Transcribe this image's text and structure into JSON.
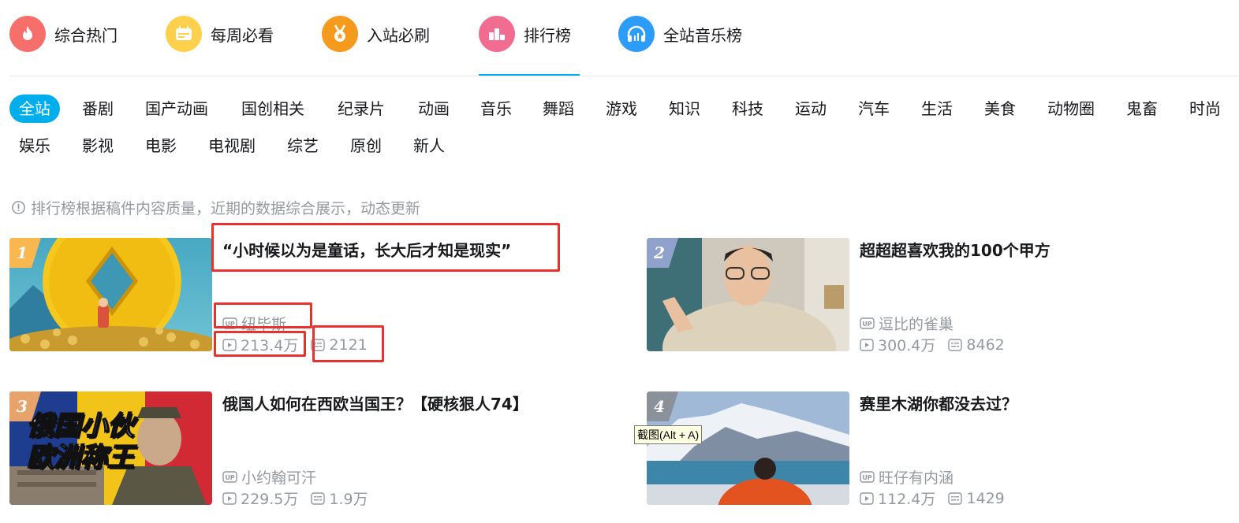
{
  "top_nav": {
    "items": [
      {
        "label": "综合热门",
        "icon": "fire-icon",
        "color": "#f66f6a"
      },
      {
        "label": "每周必看",
        "icon": "calendar-icon",
        "color": "#ffd04b"
      },
      {
        "label": "入站必刷",
        "icon": "medal-icon",
        "color": "#f49a1d"
      },
      {
        "label": "排行榜",
        "icon": "podium-icon",
        "color": "#f16c91",
        "active": true
      },
      {
        "label": "全站音乐榜",
        "icon": "headphones-icon",
        "color": "#2d9cf8"
      }
    ]
  },
  "categories": [
    "全站",
    "番剧",
    "国产动画",
    "国创相关",
    "纪录片",
    "动画",
    "音乐",
    "舞蹈",
    "游戏",
    "知识",
    "科技",
    "运动",
    "汽车",
    "生活",
    "美食",
    "动物圈",
    "鬼畜",
    "时尚",
    "娱乐",
    "影视",
    "电影",
    "电视剧",
    "综艺",
    "原创",
    "新人"
  ],
  "notice": "排行榜根据稿件内容质量，近期的数据综合展示，动态更新",
  "videos": [
    {
      "rank": "1",
      "title": "“小时候以为是童话，长大后才知是现实”",
      "uploader": "纽毕斯",
      "views": "213.4万",
      "danmaku": "2121"
    },
    {
      "rank": "2",
      "title": "超超超喜欢我的100个甲方",
      "uploader": "逗比的雀巢",
      "views": "300.4万",
      "danmaku": "8462"
    },
    {
      "rank": "3",
      "title": "俄国人如何在西欧当国王？【硬核狠人74】",
      "uploader": "小约翰可汗",
      "views": "229.5万",
      "danmaku": "1.9万",
      "thumb_text": [
        "俄国小伙",
        "欧洲称王"
      ]
    },
    {
      "rank": "4",
      "title": "赛里木湖你都没去过？",
      "uploader": "旺仔有内涵",
      "views": "112.4万",
      "danmaku": "1429"
    }
  ],
  "tooltip": "截图(Alt + A)",
  "colors": {
    "accent": "#00aeec",
    "muted": "#9499a0",
    "highlight_box": "#e8322e"
  }
}
